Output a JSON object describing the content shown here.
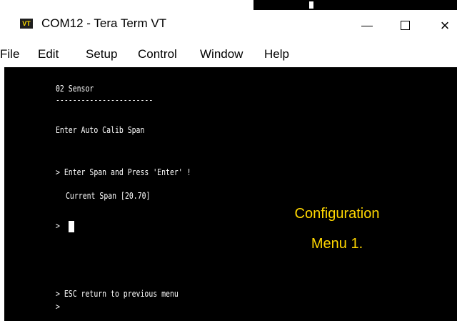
{
  "window": {
    "title": "COM12 - Tera Term VT",
    "app_icon_text": "VT",
    "controls": {
      "minimize": "—",
      "maximize": "☐",
      "close": "×"
    }
  },
  "menubar": {
    "items": [
      "File",
      "Edit",
      "Setup",
      "Control",
      "Window",
      "Help"
    ]
  },
  "terminal": {
    "lines": [
      "02 Sensor",
      "-----------------------",
      "Enter Auto Calib Span",
      "> Enter Span and Press 'Enter' !",
      "Current Span [20.70]",
      ">",
      "> ESC return to previous menu",
      ">"
    ]
  },
  "annotation": {
    "line1": "Configuration",
    "line2": "Menu 1.",
    "color": "#ffd700"
  }
}
